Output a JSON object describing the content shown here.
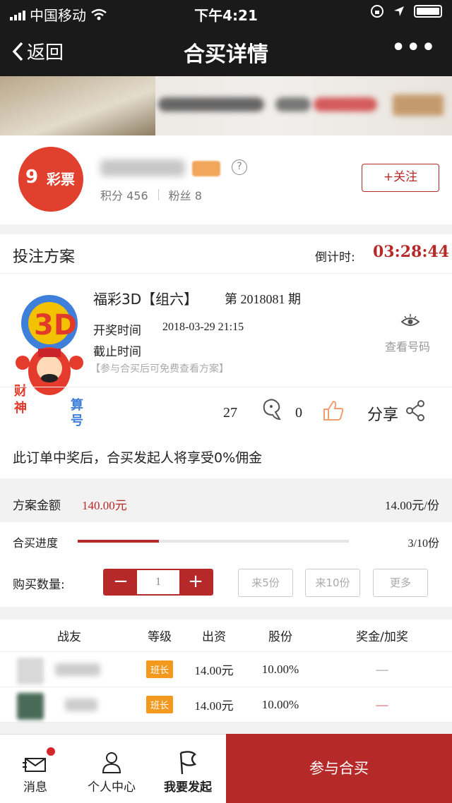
{
  "status_bar": {
    "carrier": "中国移动",
    "time": "下午4:21"
  },
  "nav": {
    "back_label": "返回",
    "title": "合买详情",
    "more": "•••"
  },
  "profile": {
    "logo_num": "9",
    "logo_text": "彩票",
    "points_label": "积分",
    "points": "456",
    "fans_label": "粉丝",
    "fans": "8",
    "follow_label": "+关注",
    "help": "?"
  },
  "plan": {
    "heading": "投注方案",
    "countdown_label": "倒计时:",
    "countdown": "03:28:44",
    "lottery_name": "福彩3D【组六】",
    "issue": "第 2018081 期",
    "draw_time_label": "开奖时间",
    "draw_time": "2018-03-29 21:15",
    "deadline_label": "截止时间",
    "hint": "【参与合买后可免费查看方案】",
    "view_code": "查看号码",
    "logo_text": {
      "left1": "财",
      "left2": "神",
      "right1": "算",
      "right2": "号"
    },
    "views": "27",
    "comments": "0",
    "share_label": "分享",
    "commission_text": "此订单中奖后，合买发起人将享受0%佣金"
  },
  "order": {
    "amount_label": "方案金额",
    "amount": "140.00元",
    "per_share": "14.00元/份",
    "progress_label": "合买进度",
    "progress_fraction": 0.3,
    "progress_text": "3/10份",
    "qty_label": "购买数量:",
    "qty_minus": "−",
    "qty_value": "1",
    "qty_plus": "+",
    "quick": [
      "来5份",
      "来10份",
      "更多"
    ]
  },
  "participants": {
    "headers": [
      "战友",
      "等级",
      "出资",
      "股份",
      "奖金/加奖"
    ],
    "rows": [
      {
        "level": "班长",
        "amount": "14.00元",
        "share": "10.00%",
        "bonus": "—"
      },
      {
        "level": "班长",
        "amount": "14.00元",
        "share": "10.00%",
        "bonus": "—"
      }
    ]
  },
  "tabbar": {
    "messages": "消息",
    "profile": "个人中心",
    "launch": "我要发起",
    "join": "参与合买"
  },
  "colors": {
    "accent": "#b52a28",
    "badge": "#f39a1e",
    "nav_bg": "#1a1a1a"
  }
}
